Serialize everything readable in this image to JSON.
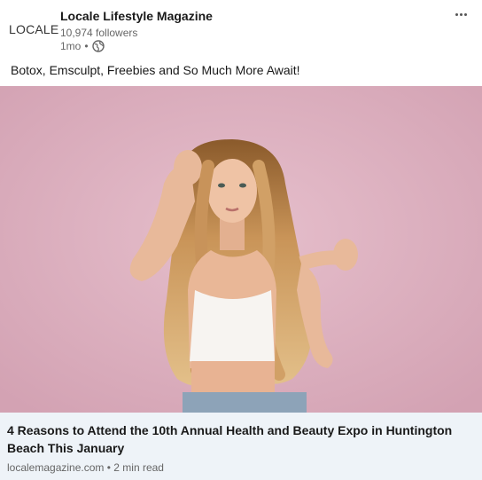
{
  "author": {
    "logo_text": "LOCALE",
    "name": "Locale Lifestyle Magazine",
    "followers": "10,974 followers",
    "age": "1mo",
    "visibility_icon": "globe-icon"
  },
  "post": {
    "text": "Botox, Emsculpt, Freebies and So Much More Await!",
    "image_alt": "Woman with long wavy blonde hair in white crop top against a pink wall"
  },
  "link": {
    "title": "4 Reasons to Attend the 10th Annual Health and Beauty Expo in Huntington Beach This January",
    "domain": "localemagazine.com",
    "read_time": "2 min read"
  },
  "colors": {
    "image_background": "#dcaebd",
    "link_card_background": "#eef3f8"
  }
}
